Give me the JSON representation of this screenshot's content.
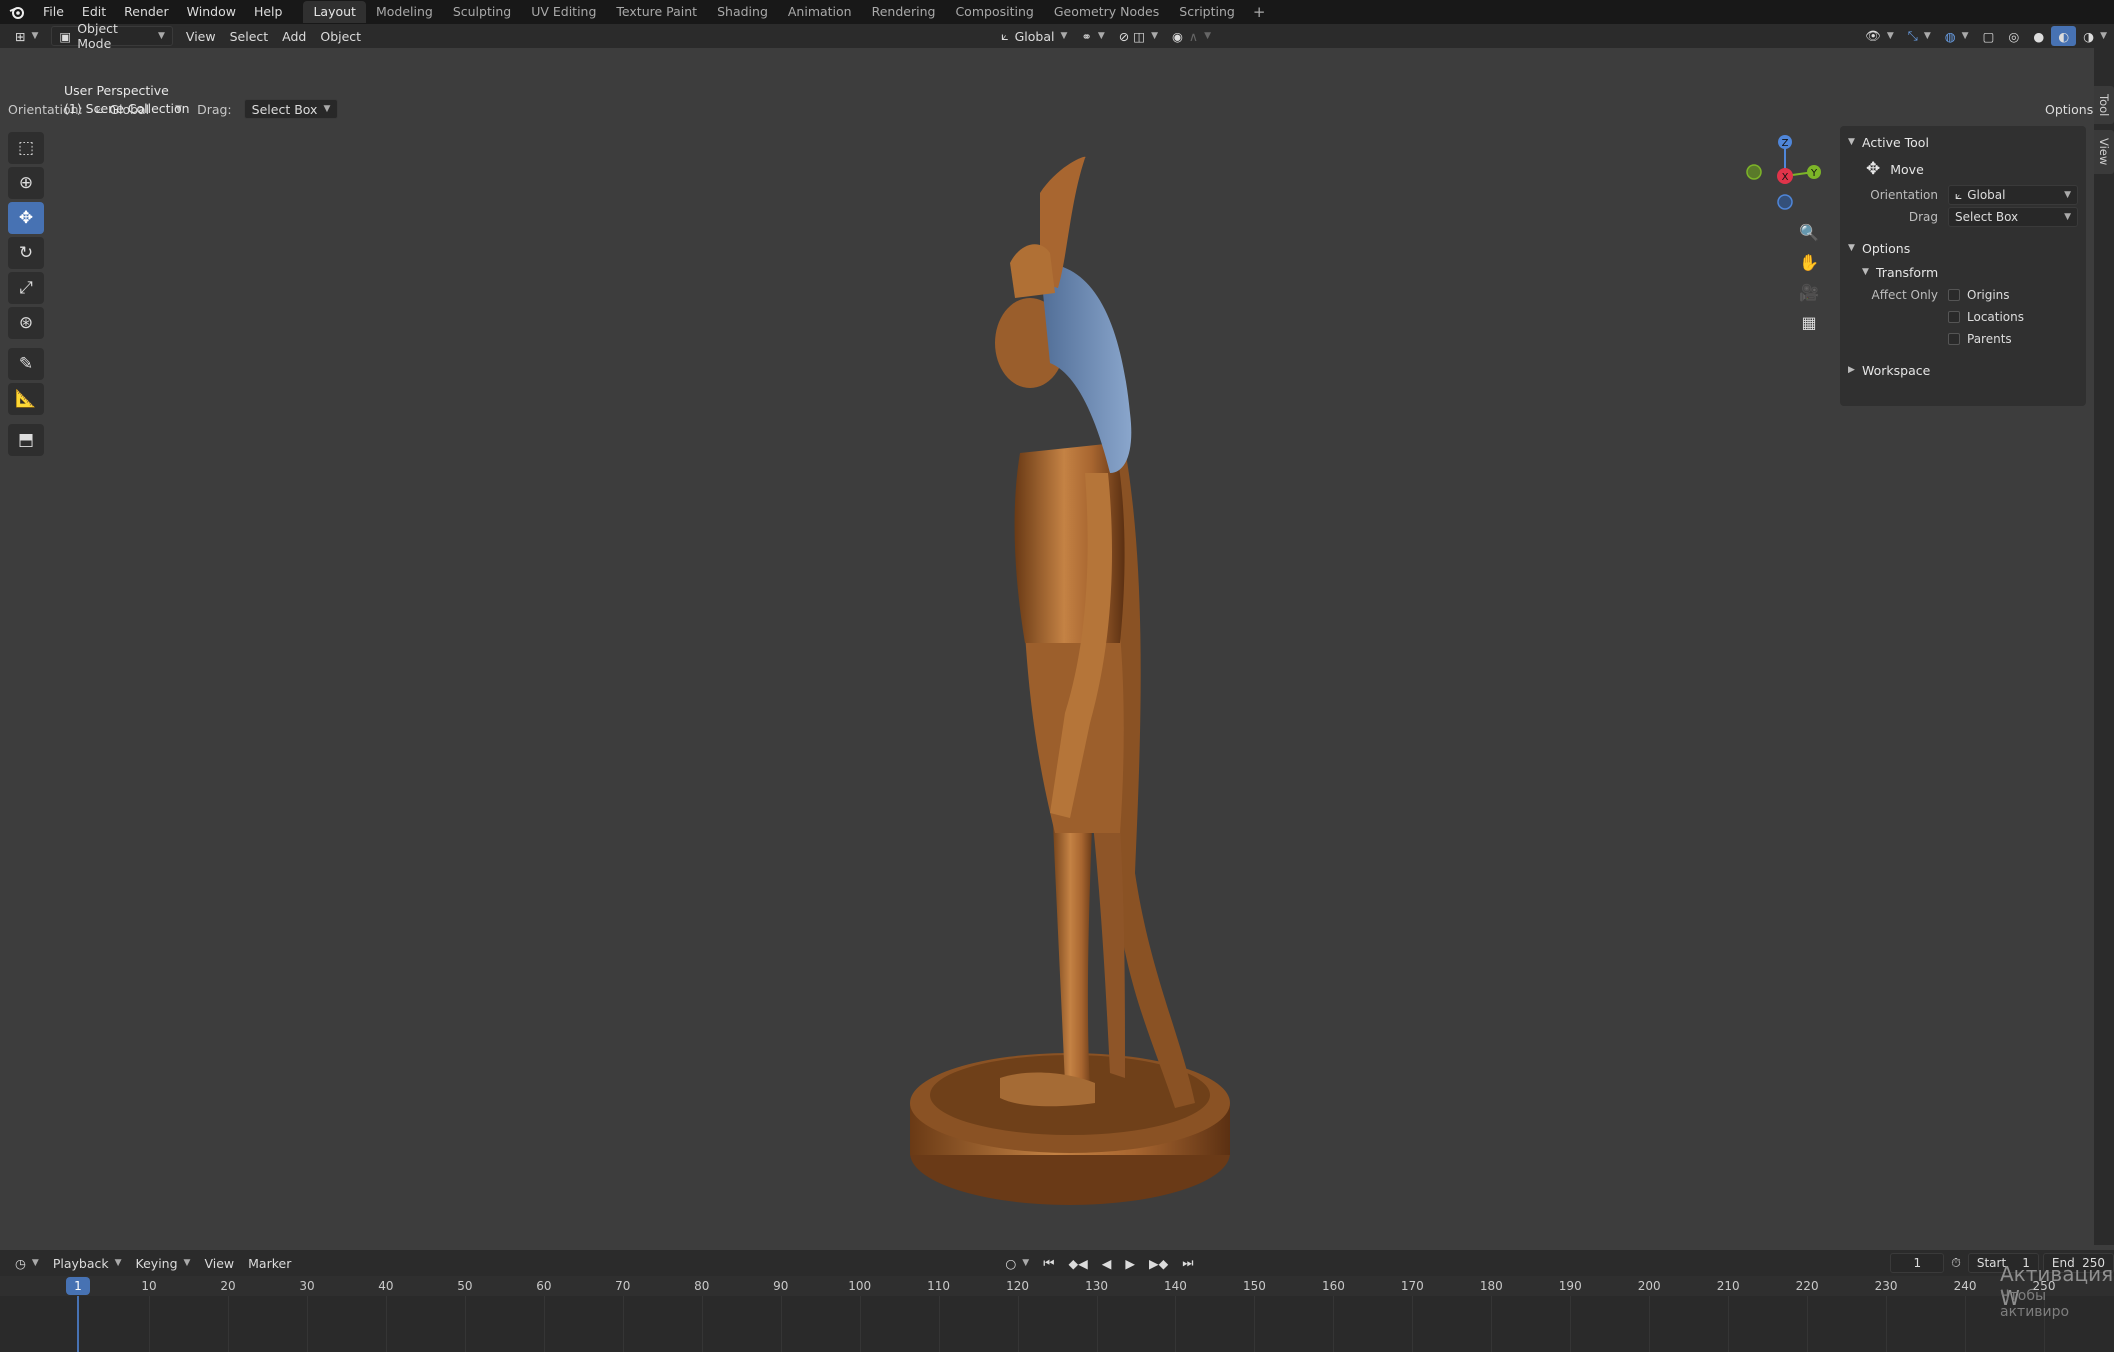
{
  "topbar": {
    "menu": [
      "File",
      "Edit",
      "Render",
      "Window",
      "Help"
    ],
    "workspaces": [
      "Layout",
      "Modeling",
      "Sculpting",
      "UV Editing",
      "Texture Paint",
      "Shading",
      "Animation",
      "Rendering",
      "Compositing",
      "Geometry Nodes",
      "Scripting"
    ],
    "active_workspace": "Layout",
    "add_label": "+"
  },
  "header": {
    "mode": "Object Mode",
    "menus": [
      "View",
      "Select",
      "Add",
      "Object"
    ],
    "orientation_global": "Global",
    "options_label": "Options"
  },
  "toolsettings": {
    "orientation_label": "Orientation:",
    "orientation_value": "Global",
    "drag_label": "Drag:",
    "drag_value": "Select Box"
  },
  "viewport": {
    "perspective": "User Perspective",
    "collection": "(1) Scene Collection",
    "gizmo": {
      "z": "Z",
      "y": "Y",
      "x": "X"
    }
  },
  "npanel": {
    "active_tool_header": "Active Tool",
    "tool_name": "Move",
    "orientation_label": "Orientation",
    "orientation_value": "Global",
    "drag_label": "Drag",
    "drag_value": "Select Box",
    "options_header": "Options",
    "transform_header": "Transform",
    "affect_only_label": "Affect Only",
    "origins": "Origins",
    "locations": "Locations",
    "parents": "Parents",
    "workspace_header": "Workspace",
    "side_tabs": [
      "Tool",
      "View"
    ]
  },
  "timeline": {
    "menus": [
      "Playback",
      "Keying",
      "View",
      "Marker"
    ],
    "current_frame": "1",
    "start_label": "Start",
    "start_value": "1",
    "end_label": "End",
    "end_value": "250",
    "ruler_ticks": [
      "1",
      "10",
      "20",
      "30",
      "40",
      "50",
      "60",
      "70",
      "80",
      "90",
      "100",
      "110",
      "120",
      "130",
      "140",
      "150",
      "160",
      "170",
      "180",
      "190",
      "200",
      "210",
      "220",
      "230",
      "240",
      "250"
    ]
  },
  "watermark": {
    "line1": "Активация W",
    "line2": "Чтобы активиро"
  },
  "colors": {
    "accent": "#4772b3",
    "viewport_bg": "#3d3d3d",
    "statue_bronze": "#b8773e",
    "headdress_blue": "#6f8fb8"
  }
}
